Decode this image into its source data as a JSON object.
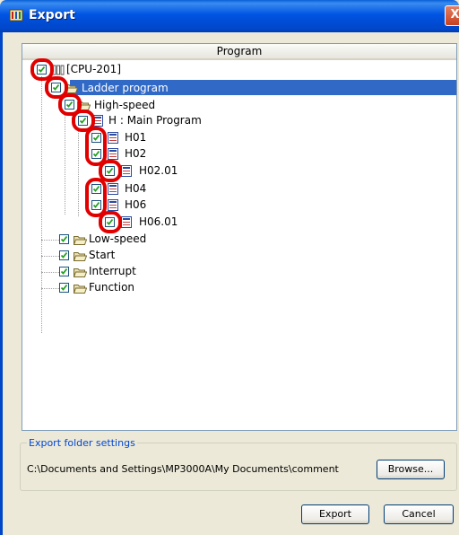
{
  "window": {
    "title": "Export",
    "close_glyph": "X"
  },
  "tree": {
    "column_header": "Program",
    "nodes": [
      {
        "label": "[CPU-201]",
        "checked": true,
        "icon": "cpu-icon",
        "highlighted": true
      },
      {
        "label": "Ladder program",
        "checked": true,
        "icon": "folder-icon",
        "selected": true,
        "highlighted": true
      },
      {
        "label": "High-speed",
        "checked": true,
        "icon": "folder-icon",
        "highlighted": true
      },
      {
        "label": "H : Main Program",
        "checked": true,
        "icon": "program-icon",
        "highlighted": true
      },
      {
        "label": "H01",
        "checked": true,
        "icon": "program-icon",
        "highlighted": true
      },
      {
        "label": "H02",
        "checked": true,
        "icon": "program-icon",
        "highlighted": true
      },
      {
        "label": "H02.01",
        "checked": true,
        "icon": "program-icon",
        "highlighted": true
      },
      {
        "label": "H04",
        "checked": true,
        "icon": "program-icon",
        "highlighted": true
      },
      {
        "label": "H06",
        "checked": true,
        "icon": "program-icon",
        "highlighted": true
      },
      {
        "label": "H06.01",
        "checked": true,
        "icon": "program-icon",
        "highlighted": true
      },
      {
        "label": "Low-speed",
        "checked": true,
        "icon": "folder-icon"
      },
      {
        "label": "Start",
        "checked": true,
        "icon": "folder-icon"
      },
      {
        "label": "Interrupt",
        "checked": true,
        "icon": "folder-icon"
      },
      {
        "label": "Function",
        "checked": true,
        "icon": "folder-icon"
      }
    ]
  },
  "export_folder": {
    "legend": "Export folder settings",
    "path": "C:\\Documents and Settings\\MP3000A\\My Documents\\comment",
    "browse_label": "Browse..."
  },
  "buttons": {
    "export_label": "Export",
    "cancel_label": "Cancel"
  },
  "colors": {
    "titlebar": "#0054e3",
    "selection": "#3169c6",
    "highlight_ring": "#e00000",
    "checkmark": "#21a121"
  }
}
